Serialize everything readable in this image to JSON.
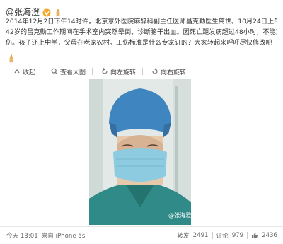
{
  "post": {
    "author_name": "@张海澄",
    "body_lines": [
      "2014年12月2日下午14时许，北京意外医院麻醉科副主任医师昌克勤医生离世。10月24日上午，年仅",
      "42岁的昌克勤工作期间在手术室内突然晕倒，诊断脑干出血。因死亡距发病超过48小时，不能算工",
      "伤。孩子还上中学，父母在老家农村。工伤标准是什么专家订的？大家转起来呼吁尽快修改吧"
    ]
  },
  "toolbar": {
    "collapse": "收起",
    "view_large": "查看大图",
    "rotate_left": "向左旋转",
    "rotate_right": "向右旋转"
  },
  "footer": {
    "time": "今天 13:01",
    "source": "来自 iPhone 5s",
    "repost_label": "转发",
    "repost_count": "2491",
    "comment_label": "评论",
    "comment_count": "979",
    "like_count": "2436"
  },
  "photo": {
    "watermark": "@张海澄"
  },
  "colors": {
    "link": "#eb7350",
    "scrub_cap": "#3f86c0",
    "mask": "#8ccbe0",
    "scrubs": "#2f8a88"
  }
}
